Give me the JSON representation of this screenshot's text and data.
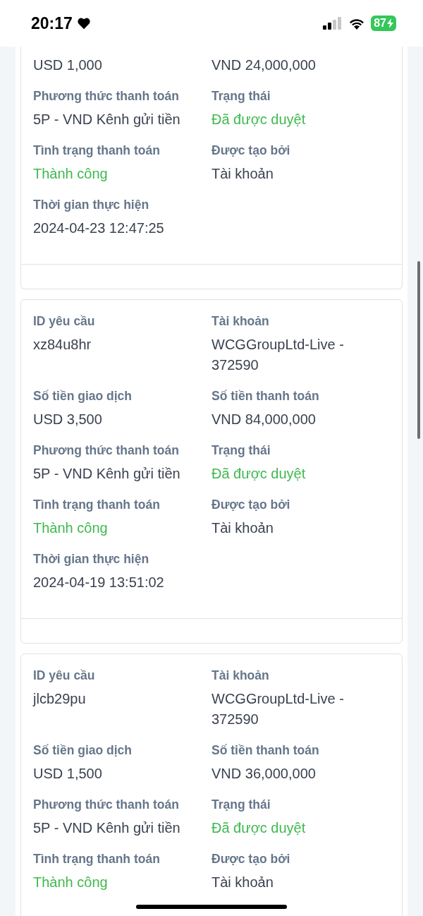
{
  "status_bar": {
    "time": "20:17",
    "battery": "87"
  },
  "cards": [
    {
      "cut_top": true,
      "fields": [
        {
          "value": "USD 1,000",
          "success": false
        },
        {
          "value": "VND 24,000,000",
          "success": false
        },
        {
          "label": "Phương thức thanh toán",
          "value": "5P - VND Kênh gửi tiền",
          "success": false
        },
        {
          "label": "Trạng thái",
          "value": "Đã được duyệt",
          "success": true
        },
        {
          "label": "Tình trạng thanh toán",
          "value": "Thành công",
          "success": true
        },
        {
          "label": "Được tạo bởi",
          "value": "Tài khoản",
          "success": false
        },
        {
          "label": "Thời gian thực hiện",
          "value": "2024-04-23 12:47:25",
          "success": false
        }
      ]
    },
    {
      "cut_top": false,
      "fields": [
        {
          "label": "ID yêu cầu",
          "value": "xz84u8hr",
          "success": false
        },
        {
          "label": "Tài khoản",
          "value": "WCGGroupLtd-Live - 372590",
          "success": false
        },
        {
          "label": "Số tiền giao dịch",
          "value": "USD 3,500",
          "success": false
        },
        {
          "label": "Số tiền thanh toán",
          "value": "VND 84,000,000",
          "success": false
        },
        {
          "label": "Phương thức thanh toán",
          "value": "5P - VND Kênh gửi tiền",
          "success": false
        },
        {
          "label": "Trạng thái",
          "value": "Đã được duyệt",
          "success": true
        },
        {
          "label": "Tình trạng thanh toán",
          "value": "Thành công",
          "success": true
        },
        {
          "label": "Được tạo bởi",
          "value": "Tài khoản",
          "success": false
        },
        {
          "label": "Thời gian thực hiện",
          "value": "2024-04-19 13:51:02",
          "success": false
        }
      ]
    },
    {
      "cut_top": false,
      "fields": [
        {
          "label": "ID yêu cầu",
          "value": "jlcb29pu",
          "success": false
        },
        {
          "label": "Tài khoản",
          "value": "WCGGroupLtd-Live - 372590",
          "success": false
        },
        {
          "label": "Số tiền giao dịch",
          "value": "USD 1,500",
          "success": false
        },
        {
          "label": "Số tiền thanh toán",
          "value": "VND 36,000,000",
          "success": false
        },
        {
          "label": "Phương thức thanh toán",
          "value": "5P - VND Kênh gửi tiền",
          "success": false
        },
        {
          "label": "Trạng thái",
          "value": "Đã được duyệt",
          "success": true
        },
        {
          "label": "Tình trạng thanh toán",
          "value": "Thành công",
          "success": true
        },
        {
          "label": "Được tạo bởi",
          "value": "Tài khoản",
          "success": false
        }
      ]
    }
  ]
}
